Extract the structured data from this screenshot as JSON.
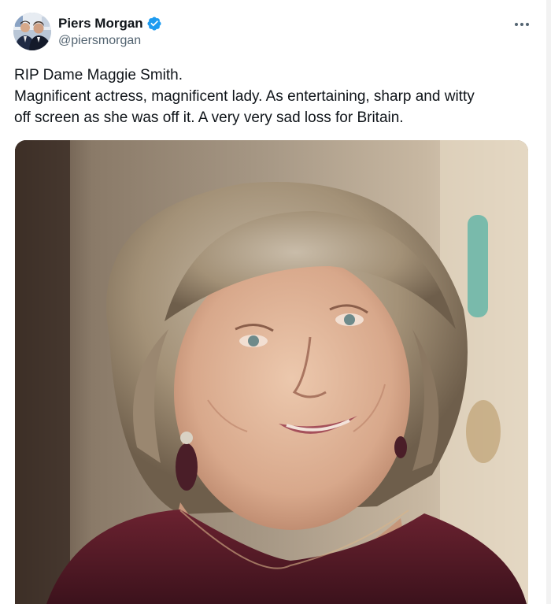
{
  "author": {
    "display_name": "Piers Morgan",
    "handle": "@piersmorgan",
    "verified": true,
    "avatar_icon": "profile-photo-two-men"
  },
  "tweet": {
    "lines": [
      "RIP Dame Maggie Smith.",
      "Magnificent actress, magnificent lady. As entertaining, sharp and witty",
      "off screen as she was off it. A very very sad loss for Britain."
    ]
  },
  "media": {
    "icon": "photo-elderly-woman-portrait"
  },
  "colors": {
    "text": "#0f1419",
    "secondary": "#536471",
    "verified_blue": "#1d9bf0"
  },
  "icons": {
    "more": "more-horizontal-icon",
    "verified": "verified-badge-icon"
  }
}
